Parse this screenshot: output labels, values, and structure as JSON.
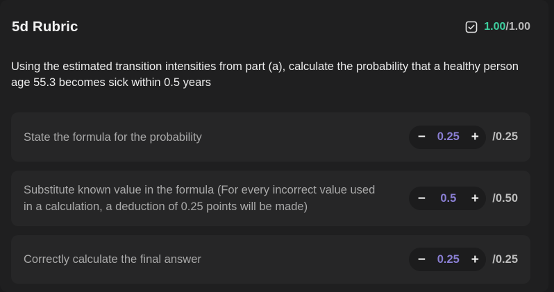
{
  "header": {
    "title": "5d Rubric",
    "score_earned": "1.00",
    "score_total": "/1.00",
    "score_icon": "checkbox-checked-icon"
  },
  "question": "Using the estimated transition intensities from part (a), calculate the probability that a healthy person age 55.3 becomes sick within 0.5 years",
  "rubric_items": [
    {
      "text": "State the formula for the probability",
      "value": "0.25",
      "max": "/0.25"
    },
    {
      "text": "Substitute known value in the formula (For every incorrect value used in a calculation, a deduction of 0.25 points will be made)",
      "value": "0.5",
      "max": "/0.50"
    },
    {
      "text": "Correctly calculate the final answer",
      "value": "0.25",
      "max": "/0.25"
    }
  ],
  "controls": {
    "decrement": "−",
    "increment": "+"
  },
  "colors": {
    "accent_green": "#3ecf9f",
    "value_purple": "#8a7fd4"
  }
}
